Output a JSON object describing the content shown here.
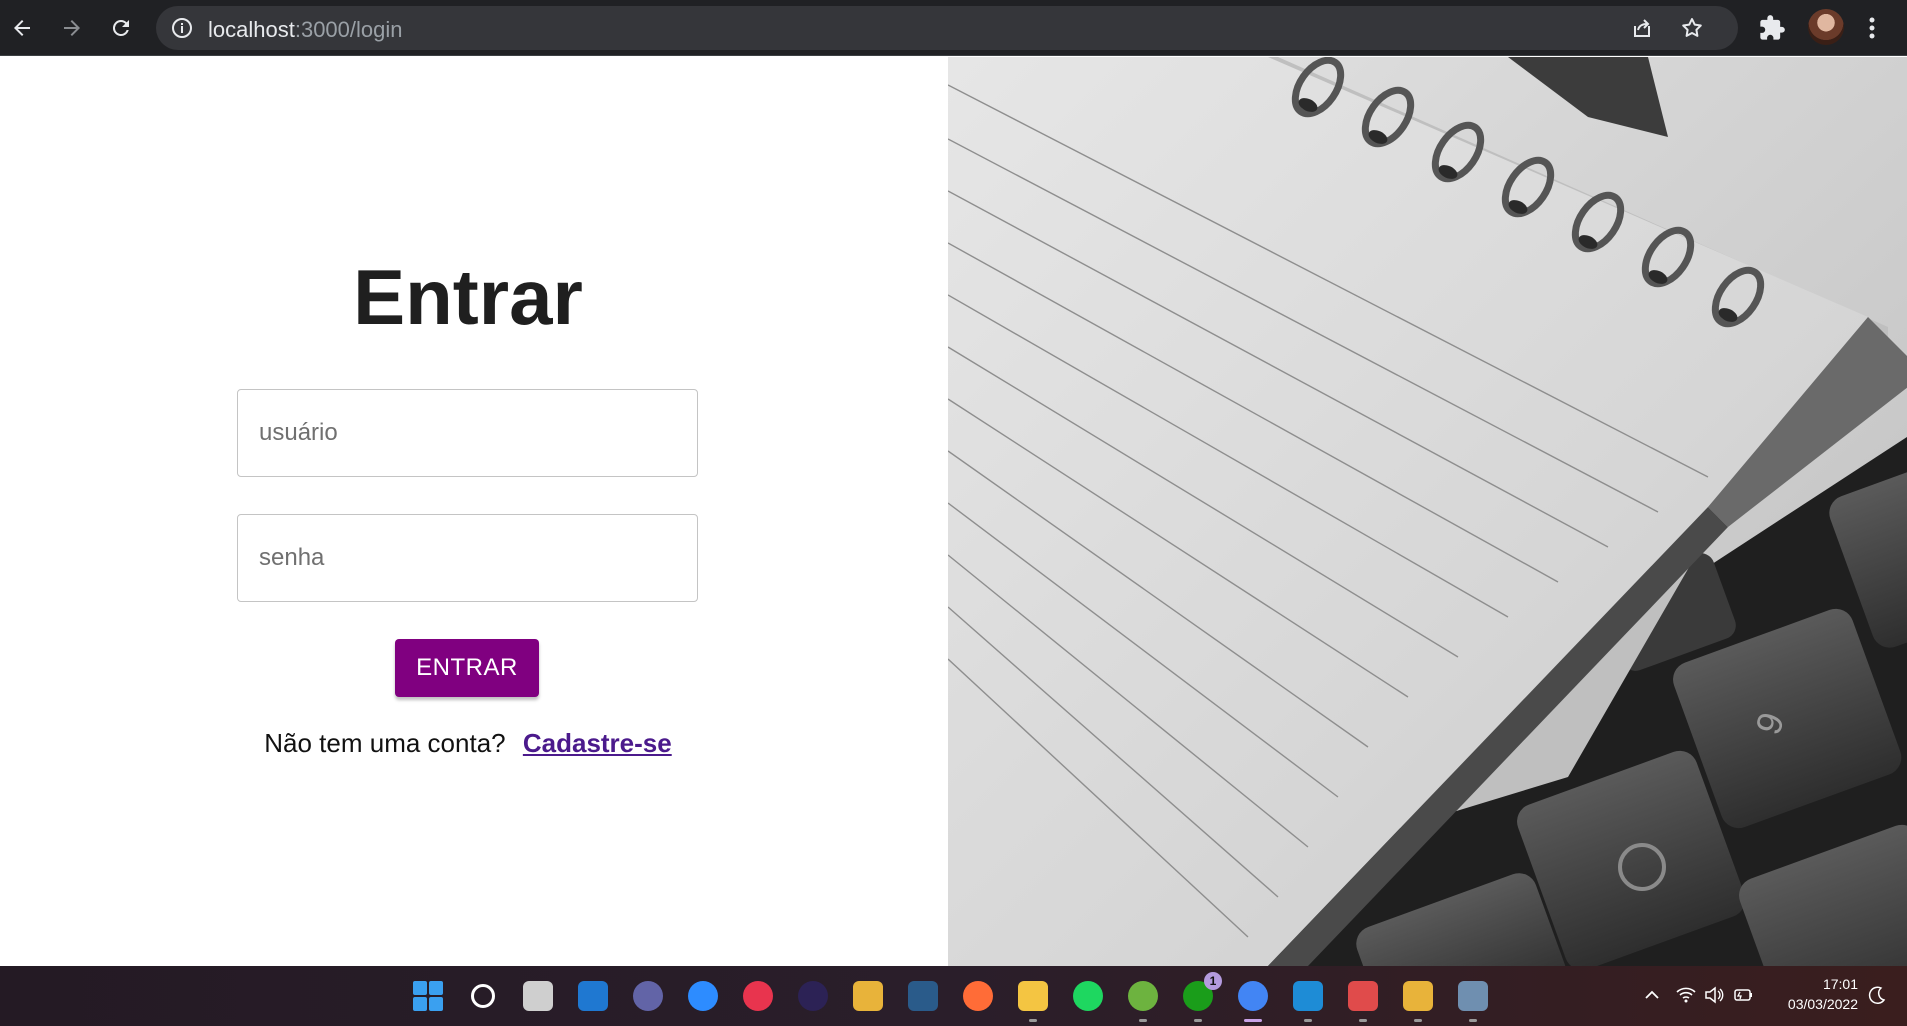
{
  "browser": {
    "url_host": "localhost",
    "url_rest": ":3000/login"
  },
  "login": {
    "title": "Entrar",
    "username_placeholder": "usuário",
    "password_placeholder": "senha",
    "submit_label": "ENTRAR",
    "signup_prompt": "Não tem uma conta?",
    "signup_link": "Cadastre-se"
  },
  "taskbar": {
    "apps": [
      {
        "name": "start",
        "color": "#3aa0f0"
      },
      {
        "name": "search",
        "color": "#ffffff"
      },
      {
        "name": "task-view",
        "color": "#cfcfcf"
      },
      {
        "name": "trello",
        "color": "#1f78d1"
      },
      {
        "name": "teams-chat",
        "color": "#6264a7"
      },
      {
        "name": "zoom",
        "color": "#2d8cff"
      },
      {
        "name": "creative-cloud",
        "color": "#e8344e"
      },
      {
        "name": "eclipse",
        "color": "#2c2255"
      },
      {
        "name": "git-kraken",
        "color": "#e8b33a"
      },
      {
        "name": "mysql-workbench",
        "color": "#2a5b8a"
      },
      {
        "name": "postman",
        "color": "#ff6c37"
      },
      {
        "name": "file-explorer",
        "color": "#f4c542"
      },
      {
        "name": "spotify",
        "color": "#1ed760"
      },
      {
        "name": "spring-tools",
        "color": "#6db33f"
      },
      {
        "name": "xbox",
        "color": "#1a9d1a"
      },
      {
        "name": "chrome",
        "color": "#4285f4"
      },
      {
        "name": "vscode",
        "color": "#1e8cd6"
      },
      {
        "name": "snipping-tool",
        "color": "#e04b4b"
      },
      {
        "name": "git-cola",
        "color": "#e8b33a"
      },
      {
        "name": "calculator",
        "color": "#6f8fb0"
      }
    ],
    "xbox_badge": "1",
    "time": "17:01",
    "date": "03/03/2022"
  }
}
